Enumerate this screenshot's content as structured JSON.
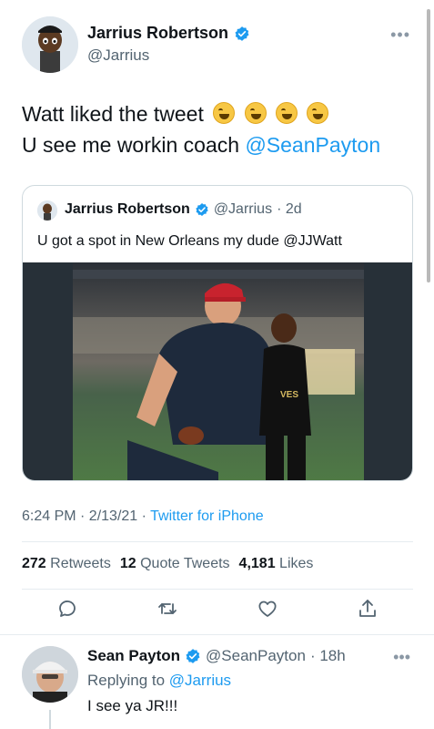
{
  "tweet": {
    "author_name": "Jarrius Robertson",
    "author_handle": "@Jarrius",
    "line1": "Watt liked the tweet",
    "line2_prefix": "U see me workin coach ",
    "line2_mention": "@SeanPayton",
    "emoji_name": "rolling-on-floor-laughing-emoji",
    "emoji_count": 4,
    "timestamp": "6:24 PM · 2/13/21 · ",
    "source": "Twitter for iPhone",
    "stats": {
      "retweets_count": "272",
      "retweets_label": "Retweets",
      "quotes_count": "12",
      "quotes_label": "Quote Tweets",
      "likes_count": "4,181",
      "likes_label": "Likes"
    }
  },
  "quoted": {
    "author_name": "Jarrius Robertson",
    "author_handle": "@Jarrius",
    "time": "· 2d",
    "text": "U got a spot in New Orleans my dude @JJWatt"
  },
  "reply": {
    "author_name": "Sean Payton",
    "author_handle": "@SeanPayton",
    "time": "· 18h",
    "replying_prefix": "Replying to ",
    "replying_to": "@Jarrius",
    "text": "I see ya JR!!!"
  },
  "icons": {
    "verified": "verified-badge-icon",
    "more": "more-options-icon",
    "reply": "reply-icon",
    "retweet": "retweet-icon",
    "like": "heart-icon",
    "share": "share-icon"
  },
  "colors": {
    "accent": "#1d9bf0",
    "secondary_text": "#536471",
    "border": "#cfd9de"
  }
}
